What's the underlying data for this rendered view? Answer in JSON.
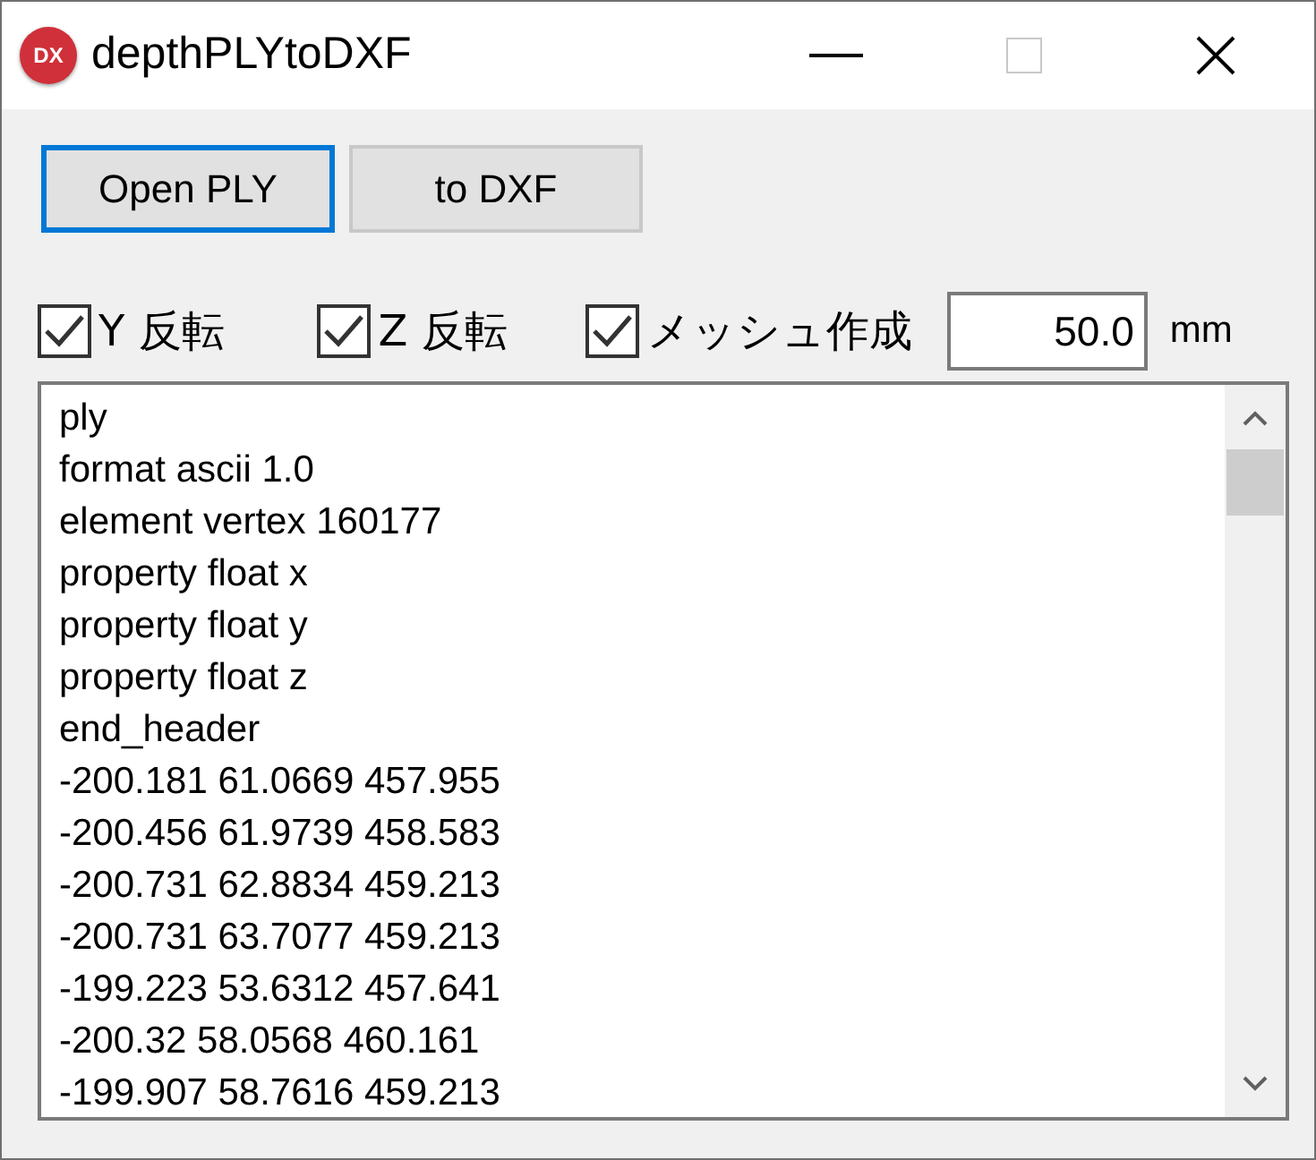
{
  "window": {
    "title": "depthPLYtoDXF",
    "app_icon_text": "DX"
  },
  "buttons": [
    {
      "label": "Open PLY",
      "focused": true
    },
    {
      "label": "to DXF",
      "focused": false
    }
  ],
  "options": [
    {
      "label": "Y 反転",
      "checked": true
    },
    {
      "label": "Z 反転",
      "checked": true
    },
    {
      "label": "メッシュ作成",
      "checked": true
    }
  ],
  "mesh_size": {
    "value": "50.0",
    "unit": "mm"
  },
  "output_lines": [
    "ply",
    "format ascii 1.0",
    "element vertex 160177",
    "property float x",
    "property float y",
    "property float z",
    "end_header",
    "-200.181 61.0669 457.955",
    "-200.456 61.9739 458.583",
    "-200.731 62.8834 459.213",
    "-200.731 63.7077 459.213",
    "-199.223 53.6312 457.641",
    "-200.32 58.0568 460.161",
    "-199.907 58.7616 459.213"
  ]
}
